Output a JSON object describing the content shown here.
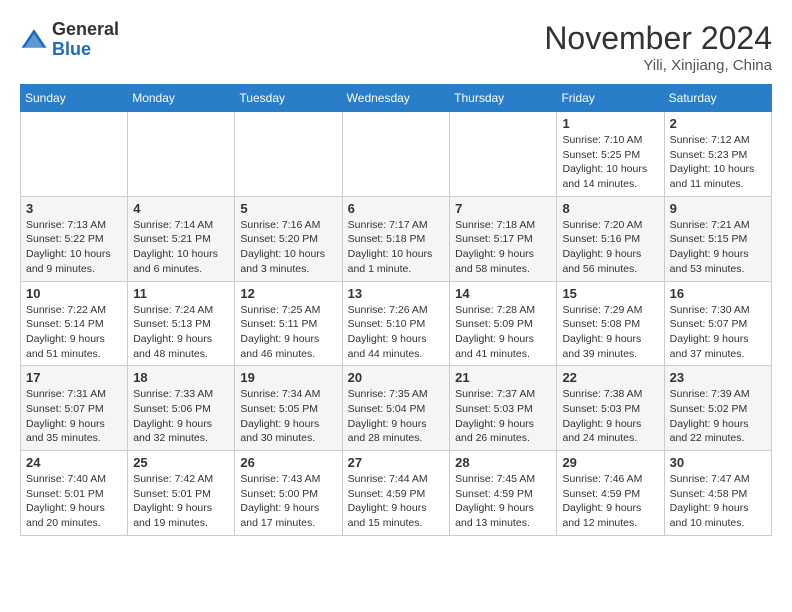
{
  "logo": {
    "general": "General",
    "blue": "Blue"
  },
  "title": "November 2024",
  "location": "Yili, Xinjiang, China",
  "weekdays": [
    "Sunday",
    "Monday",
    "Tuesday",
    "Wednesday",
    "Thursday",
    "Friday",
    "Saturday"
  ],
  "weeks": [
    [
      {
        "day": "",
        "info": ""
      },
      {
        "day": "",
        "info": ""
      },
      {
        "day": "",
        "info": ""
      },
      {
        "day": "",
        "info": ""
      },
      {
        "day": "",
        "info": ""
      },
      {
        "day": "1",
        "info": "Sunrise: 7:10 AM\nSunset: 5:25 PM\nDaylight: 10 hours and 14 minutes."
      },
      {
        "day": "2",
        "info": "Sunrise: 7:12 AM\nSunset: 5:23 PM\nDaylight: 10 hours and 11 minutes."
      }
    ],
    [
      {
        "day": "3",
        "info": "Sunrise: 7:13 AM\nSunset: 5:22 PM\nDaylight: 10 hours and 9 minutes."
      },
      {
        "day": "4",
        "info": "Sunrise: 7:14 AM\nSunset: 5:21 PM\nDaylight: 10 hours and 6 minutes."
      },
      {
        "day": "5",
        "info": "Sunrise: 7:16 AM\nSunset: 5:20 PM\nDaylight: 10 hours and 3 minutes."
      },
      {
        "day": "6",
        "info": "Sunrise: 7:17 AM\nSunset: 5:18 PM\nDaylight: 10 hours and 1 minute."
      },
      {
        "day": "7",
        "info": "Sunrise: 7:18 AM\nSunset: 5:17 PM\nDaylight: 9 hours and 58 minutes."
      },
      {
        "day": "8",
        "info": "Sunrise: 7:20 AM\nSunset: 5:16 PM\nDaylight: 9 hours and 56 minutes."
      },
      {
        "day": "9",
        "info": "Sunrise: 7:21 AM\nSunset: 5:15 PM\nDaylight: 9 hours and 53 minutes."
      }
    ],
    [
      {
        "day": "10",
        "info": "Sunrise: 7:22 AM\nSunset: 5:14 PM\nDaylight: 9 hours and 51 minutes."
      },
      {
        "day": "11",
        "info": "Sunrise: 7:24 AM\nSunset: 5:13 PM\nDaylight: 9 hours and 48 minutes."
      },
      {
        "day": "12",
        "info": "Sunrise: 7:25 AM\nSunset: 5:11 PM\nDaylight: 9 hours and 46 minutes."
      },
      {
        "day": "13",
        "info": "Sunrise: 7:26 AM\nSunset: 5:10 PM\nDaylight: 9 hours and 44 minutes."
      },
      {
        "day": "14",
        "info": "Sunrise: 7:28 AM\nSunset: 5:09 PM\nDaylight: 9 hours and 41 minutes."
      },
      {
        "day": "15",
        "info": "Sunrise: 7:29 AM\nSunset: 5:08 PM\nDaylight: 9 hours and 39 minutes."
      },
      {
        "day": "16",
        "info": "Sunrise: 7:30 AM\nSunset: 5:07 PM\nDaylight: 9 hours and 37 minutes."
      }
    ],
    [
      {
        "day": "17",
        "info": "Sunrise: 7:31 AM\nSunset: 5:07 PM\nDaylight: 9 hours and 35 minutes."
      },
      {
        "day": "18",
        "info": "Sunrise: 7:33 AM\nSunset: 5:06 PM\nDaylight: 9 hours and 32 minutes."
      },
      {
        "day": "19",
        "info": "Sunrise: 7:34 AM\nSunset: 5:05 PM\nDaylight: 9 hours and 30 minutes."
      },
      {
        "day": "20",
        "info": "Sunrise: 7:35 AM\nSunset: 5:04 PM\nDaylight: 9 hours and 28 minutes."
      },
      {
        "day": "21",
        "info": "Sunrise: 7:37 AM\nSunset: 5:03 PM\nDaylight: 9 hours and 26 minutes."
      },
      {
        "day": "22",
        "info": "Sunrise: 7:38 AM\nSunset: 5:03 PM\nDaylight: 9 hours and 24 minutes."
      },
      {
        "day": "23",
        "info": "Sunrise: 7:39 AM\nSunset: 5:02 PM\nDaylight: 9 hours and 22 minutes."
      }
    ],
    [
      {
        "day": "24",
        "info": "Sunrise: 7:40 AM\nSunset: 5:01 PM\nDaylight: 9 hours and 20 minutes."
      },
      {
        "day": "25",
        "info": "Sunrise: 7:42 AM\nSunset: 5:01 PM\nDaylight: 9 hours and 19 minutes."
      },
      {
        "day": "26",
        "info": "Sunrise: 7:43 AM\nSunset: 5:00 PM\nDaylight: 9 hours and 17 minutes."
      },
      {
        "day": "27",
        "info": "Sunrise: 7:44 AM\nSunset: 4:59 PM\nDaylight: 9 hours and 15 minutes."
      },
      {
        "day": "28",
        "info": "Sunrise: 7:45 AM\nSunset: 4:59 PM\nDaylight: 9 hours and 13 minutes."
      },
      {
        "day": "29",
        "info": "Sunrise: 7:46 AM\nSunset: 4:59 PM\nDaylight: 9 hours and 12 minutes."
      },
      {
        "day": "30",
        "info": "Sunrise: 7:47 AM\nSunset: 4:58 PM\nDaylight: 9 hours and 10 minutes."
      }
    ]
  ]
}
